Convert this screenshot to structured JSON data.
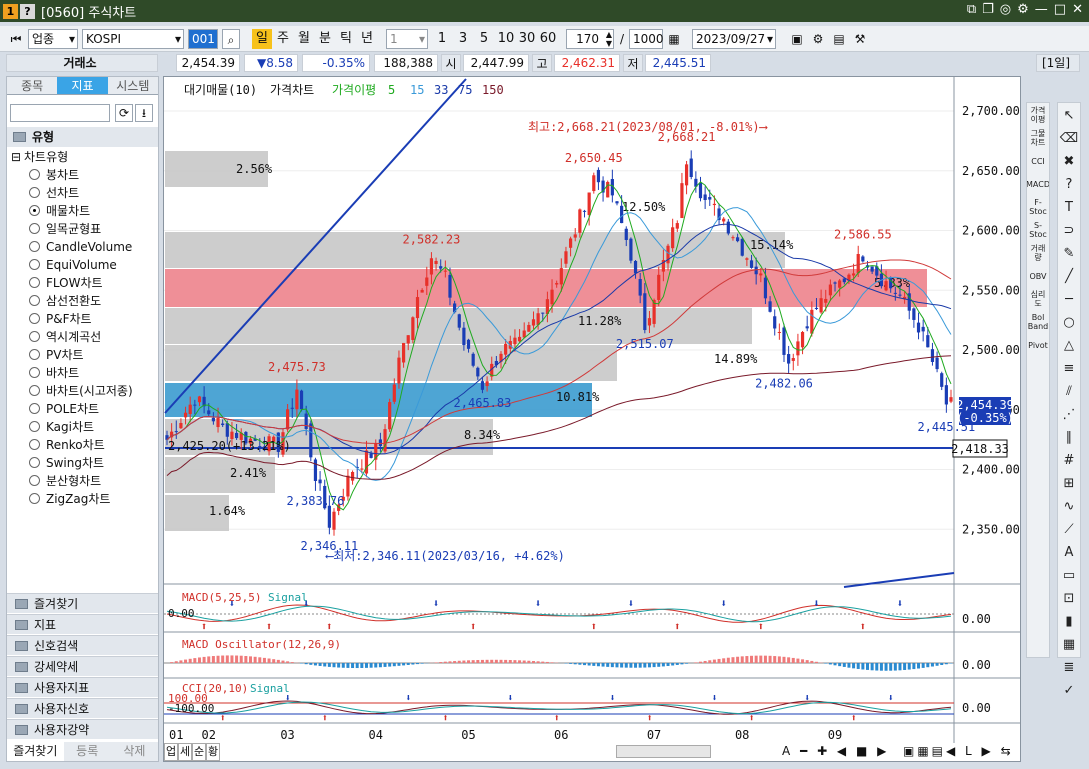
{
  "window": {
    "badges": [
      "1",
      "?"
    ],
    "title": "[0560] 주식차트",
    "controls": [
      "⧉",
      "❐",
      "◎",
      "⚙",
      "—",
      "□",
      "✕"
    ]
  },
  "toolbar": {
    "market": "업종",
    "code": "KOSPI",
    "code_short": "001",
    "periods": [
      "일",
      "주",
      "월",
      "분",
      "틱",
      "년"
    ],
    "interval": "1",
    "counts": [
      "1",
      "3",
      "5",
      "10",
      "30",
      "60"
    ],
    "view_count": "170",
    "total_count": "1000",
    "date": "2023/09/27",
    "icons": [
      "save-icon",
      "settings-icon",
      "print-icon",
      "tools-icon"
    ]
  },
  "quote": {
    "exchange": "거래소",
    "price": "2,454.39",
    "change": "▼8.58",
    "change_pct": "-0.35%",
    "volume": "188,388",
    "open_label": "시",
    "open": "2,447.99",
    "high_label": "고",
    "high": "2,462.31",
    "low_label": "저",
    "low": "2,445.51",
    "period_badge": "[1일]"
  },
  "left": {
    "tabs": [
      "종목",
      "지표",
      "시스템"
    ],
    "section": "유형",
    "group": "차트유형",
    "chart_types": [
      "봉차트",
      "선차트",
      "매물차트",
      "일목균형표",
      "CandleVolume",
      "EquiVolume",
      "FLOW차트",
      "삼선전환도",
      "P&F차트",
      "역시계곡선",
      "PV차트",
      "바차트",
      "바차트(시고저종)",
      "POLE차트",
      "Kagi차트",
      "Renko차트",
      "Swing차트",
      "분산형차트",
      "ZigZag차트"
    ],
    "selected_index": 2,
    "folders": [
      "즐겨찾기",
      "지표",
      "신호검색",
      "강세약세",
      "사용자지표",
      "사용자신호",
      "사용자강약"
    ],
    "bottom_tabs": [
      "즐겨찾기",
      "등록",
      "삭제"
    ]
  },
  "chart": {
    "legend": {
      "volume_profile": "대기매물(10)",
      "price": "가격차트",
      "ma": "가격이평",
      "ma_periods": [
        "5",
        "15",
        "33",
        "75",
        "150"
      ]
    },
    "annotations": {
      "high": "최고:2,668.21(2023/08/01, -8.01%)⟶",
      "low": "⟵최저:2,346.11(2023/03/16, +4.62%)",
      "left_edge": "2,425.20(+13.21%)"
    },
    "price_labels": [
      {
        "text": "2,668.21",
        "price": 2668.21,
        "day": 112
      },
      {
        "text": "2,650.45",
        "price": 2650.45,
        "day": 92
      },
      {
        "text": "2,582.23",
        "price": 2582.23,
        "day": 57
      },
      {
        "text": "2,586.55",
        "price": 2586.55,
        "day": 150
      },
      {
        "text": "2,475.73",
        "price": 2475.73,
        "day": 28
      },
      {
        "text": "2,465.83",
        "price": 2465.83,
        "day": 68
      },
      {
        "text": "2,515.07",
        "price": 2515.07,
        "day": 103
      },
      {
        "text": "2,482.06",
        "price": 2482.06,
        "day": 133
      },
      {
        "text": "2,383.76",
        "price": 2383.76,
        "day": 32
      },
      {
        "text": "2,346.11",
        "price": 2346.11,
        "day": 35
      },
      {
        "text": "2,445.51",
        "price": 2445.51,
        "day": 168
      }
    ],
    "volume_profile_pct": [
      "1.64%",
      "2.41%",
      "8.34%",
      "10.81%",
      "11.28%",
      "14.89%",
      "12.50%",
      "15.14%",
      "5.83%",
      "2.56%"
    ],
    "y_ticks": [
      "2,700.00",
      "2,650.00",
      "2,600.00",
      "2,550.00",
      "2,500.00",
      "2,450.00",
      "2,400.00",
      "2,350.00"
    ],
    "current_price": "2,454.39",
    "current_pct": "(-0.35%)",
    "crosshair_price": "2,418.33",
    "x_ticks": [
      "01",
      "02",
      "03",
      "04",
      "05",
      "06",
      "07",
      "08",
      "09"
    ],
    "bottom_buttons": [
      "업",
      "세",
      "순",
      "황"
    ],
    "macd": {
      "label": "MACD(5,25,5)",
      "signal": "Signal",
      "zero_left": "0.00",
      "value": "0.00"
    },
    "osc": {
      "label": "MACD Oscillator(12,26,9)",
      "value": "0.00"
    },
    "cci": {
      "label": "CCI(20,10)",
      "signal": "Signal",
      "upper": "100.00",
      "lower": "-100.00",
      "value": "0.00"
    }
  },
  "right_tools_1": [
    "가격이평",
    "그물차트",
    "CCI",
    "MACD",
    "F-Stoc",
    "S-Stoc",
    "거래량",
    "OBV",
    "심리도",
    "Bol Band",
    "Pivot"
  ],
  "colors": {
    "up": "#e8302a",
    "down": "#1a3db5",
    "ma5": "#1faa1f",
    "ma15": "#3a9ad9",
    "ma33": "#1a3aa8",
    "ma75": "#d03a3a",
    "ma150": "#7a1a2a",
    "band_pink": "#ef8f97",
    "band_blue": "#3b9bcf",
    "band_gray": "#c8c8c8"
  }
}
